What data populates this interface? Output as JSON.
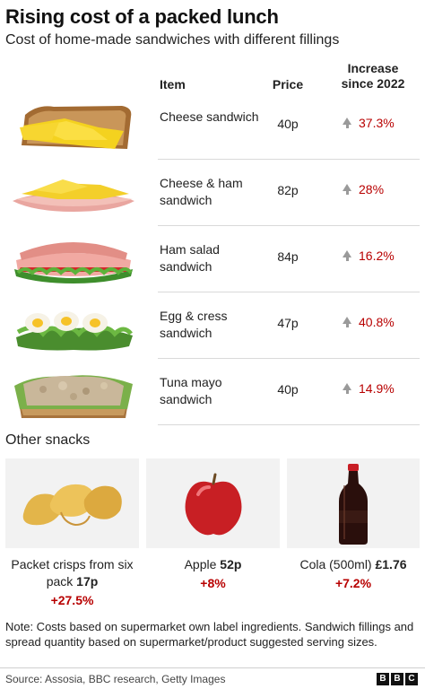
{
  "title": "Rising cost of a packed lunch",
  "subtitle": "Cost of home-made sandwiches with different fillings",
  "table": {
    "headers": {
      "item": "Item",
      "price": "Price",
      "increase": "Increase since 2022"
    },
    "rows": [
      {
        "item": "Cheese sandwich",
        "price": "40p",
        "increase": "37.3%",
        "image": "cheese-sandwich-photo"
      },
      {
        "item": "Cheese & ham sandwich",
        "price": "82p",
        "increase": "28%",
        "image": "cheese-ham-sandwich-photo"
      },
      {
        "item": "Ham salad sandwich",
        "price": "84p",
        "increase": "16.2%",
        "image": "ham-salad-sandwich-photo"
      },
      {
        "item": "Egg & cress sandwich",
        "price": "47p",
        "increase": "40.8%",
        "image": "egg-cress-sandwich-photo"
      },
      {
        "item": "Tuna mayo sandwich",
        "price": "40p",
        "increase": "14.9%",
        "image": "tuna-mayo-sandwich-photo"
      }
    ]
  },
  "other_snacks": {
    "title": "Other snacks",
    "items": [
      {
        "name": "Packet crisps from six pack",
        "price": "17p",
        "increase": "+27.5%",
        "image": "crisps-photo"
      },
      {
        "name": "Apple",
        "price": "52p",
        "increase": "+8%",
        "image": "apple-photo"
      },
      {
        "name": "Cola (500ml)",
        "price": "£1.76",
        "increase": "+7.2%",
        "image": "cola-bottle-photo"
      }
    ]
  },
  "note": "Note: Costs based on supermarket own label ingredients. Sandwich fillings and spread quantity based on supermarket/product suggested serving sizes.",
  "source": "Source: Assosia, BBC research, Getty Images",
  "logo": {
    "letters": [
      "B",
      "B",
      "C"
    ]
  },
  "colors": {
    "increase_red": "#b80000",
    "arrow_grey": "#9a9a9a",
    "card_bg": "#f2f2f2"
  }
}
